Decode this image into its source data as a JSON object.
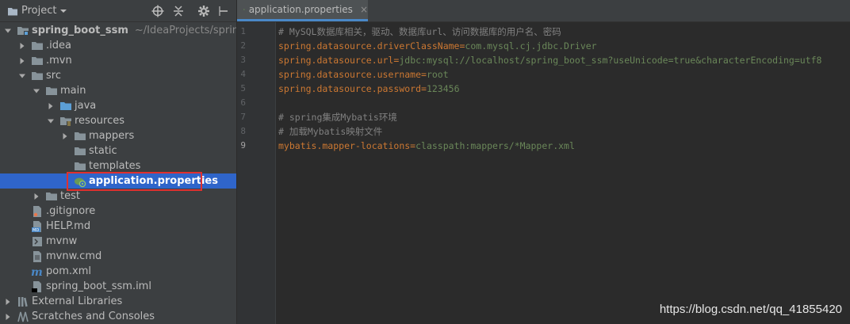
{
  "panel": {
    "title": "Project",
    "icons": [
      "target-icon",
      "collapse-icon",
      "gear-icon",
      "hide-icon"
    ]
  },
  "tree": [
    {
      "label": "spring_boot_ssm",
      "hint": "~/IdeaProjects/spring_b",
      "depth": 0,
      "expanded": true,
      "icon": "module-folder",
      "bold": true
    },
    {
      "label": ".idea",
      "depth": 1,
      "expanded": false,
      "icon": "folder"
    },
    {
      "label": ".mvn",
      "depth": 1,
      "expanded": false,
      "icon": "folder"
    },
    {
      "label": "src",
      "depth": 1,
      "expanded": true,
      "icon": "folder"
    },
    {
      "label": "main",
      "depth": 2,
      "expanded": true,
      "icon": "folder"
    },
    {
      "label": "java",
      "depth": 3,
      "expanded": false,
      "icon": "source-folder"
    },
    {
      "label": "resources",
      "depth": 3,
      "expanded": true,
      "icon": "resources-folder"
    },
    {
      "label": "mappers",
      "depth": 4,
      "expanded": false,
      "icon": "folder"
    },
    {
      "label": "static",
      "depth": 4,
      "icon": "folder"
    },
    {
      "label": "templates",
      "depth": 4,
      "icon": "folder"
    },
    {
      "label": "application.properties",
      "depth": 4,
      "icon": "spring-properties",
      "selected": true,
      "bold": true
    },
    {
      "label": "test",
      "depth": 2,
      "expanded": false,
      "icon": "folder"
    },
    {
      "label": ".gitignore",
      "depth": 1,
      "icon": "gitignore-file"
    },
    {
      "label": "HELP.md",
      "depth": 1,
      "icon": "markdown-file"
    },
    {
      "label": "mvnw",
      "depth": 1,
      "icon": "shell-file"
    },
    {
      "label": "mvnw.cmd",
      "depth": 1,
      "icon": "text-file"
    },
    {
      "label": "pom.xml",
      "depth": 1,
      "icon": "maven-file"
    },
    {
      "label": "spring_boot_ssm.iml",
      "depth": 1,
      "icon": "iml-file"
    },
    {
      "label": "External Libraries",
      "depth": 0,
      "expanded": false,
      "icon": "libraries"
    },
    {
      "label": "Scratches and Consoles",
      "depth": 0,
      "expanded": false,
      "icon": "scratches"
    }
  ],
  "editor": {
    "tab": {
      "label": "application.properties",
      "close": "×"
    },
    "current_line": 9,
    "lines": [
      {
        "n": "1",
        "type": "comment",
        "text": "# MySQL数据库相关，驱动、数据库url、访问数据库的用户名、密码"
      },
      {
        "n": "2",
        "type": "prop",
        "key": "spring.datasource.driverClassName",
        "eq": "=",
        "value": "com.mysql.cj.jdbc.Driver"
      },
      {
        "n": "3",
        "type": "prop",
        "key": "spring.datasource.url",
        "eq": "=",
        "value": "jdbc:mysql://localhost/spring_boot_ssm?useUnicode=true&characterEncoding=utf8"
      },
      {
        "n": "4",
        "type": "prop",
        "key": "spring.datasource.username",
        "eq": "=",
        "value": "root"
      },
      {
        "n": "5",
        "type": "prop",
        "key": "spring.datasource.password",
        "eq": "=",
        "value": "123456"
      },
      {
        "n": "6",
        "type": "blank",
        "text": ""
      },
      {
        "n": "7",
        "type": "comment",
        "text": "# spring集成Mybatis环境"
      },
      {
        "n": "8",
        "type": "comment",
        "text": "# 加载Mybatis映射文件"
      },
      {
        "n": "9",
        "type": "prop",
        "key": "mybatis.mapper-locations",
        "eq": "=",
        "value": "classpath:mappers/*Mapper.xml"
      }
    ]
  },
  "watermark": "https://blog.csdn.net/qq_41855420",
  "colors": {
    "selection": "#2f65ca",
    "highlight_border": "#e0302e",
    "prop_key": "#cc7832",
    "prop_value": "#6a8759",
    "comment": "#808080"
  }
}
